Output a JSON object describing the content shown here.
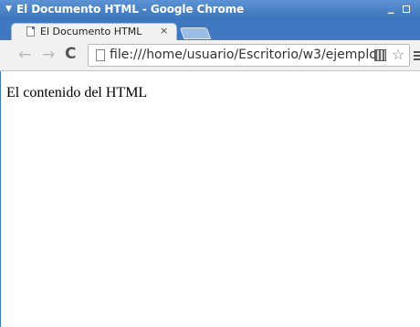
{
  "window": {
    "title": "El Documento HTML - Google Chrome",
    "minimize_glyph": "_",
    "close_glyph": "?"
  },
  "tabs": [
    {
      "title": "El Documento HTML",
      "close_glyph": "×",
      "active": true
    }
  ],
  "toolbar": {
    "back_glyph": "←",
    "forward_glyph": "→",
    "reload_glyph": "C",
    "address": "file:///home/usuario/Escritorio/w3/ejemplo",
    "star_glyph": "☆"
  },
  "page": {
    "body_text": "El contenido del HTML"
  },
  "colors": {
    "titlebar": "#3b73b8",
    "tabstrip": "#3f78c0",
    "toolbar": "#f1f1f1"
  }
}
